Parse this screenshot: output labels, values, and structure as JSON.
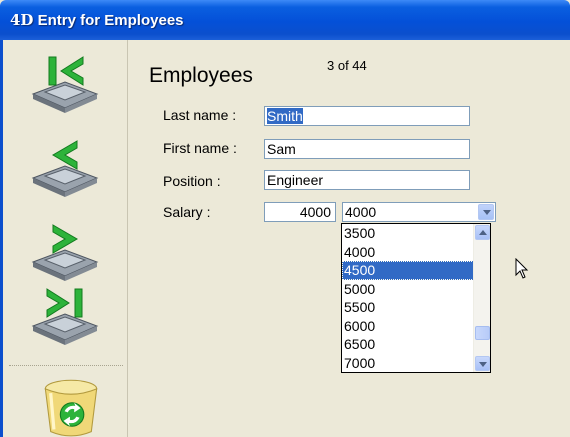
{
  "window": {
    "logo": "4D",
    "title": "Entry for Employees"
  },
  "toolbar": {
    "buttons": [
      {
        "name": "first-record",
        "icon": "first-record-icon"
      },
      {
        "name": "previous-record",
        "icon": "previous-record-icon"
      },
      {
        "name": "next-record",
        "icon": "next-record-icon"
      },
      {
        "name": "last-record",
        "icon": "last-record-icon"
      },
      {
        "name": "delete-record",
        "icon": "trash-icon"
      }
    ]
  },
  "form": {
    "title": "Employees",
    "counter": "3 of 44",
    "last_name_label": "Last name :",
    "last_name_value": "Smith",
    "first_name_label": "First name :",
    "first_name_value": "Sam",
    "position_label": "Position :",
    "position_value": "Engineer",
    "salary_label": "Salary :",
    "salary_value": "4000",
    "salary_combo_value": "4000",
    "salary_options": [
      "3500",
      "4000",
      "4500",
      "5000",
      "5500",
      "6000",
      "6500",
      "7000"
    ],
    "salary_highlighted": "4500"
  },
  "colors": {
    "titlebar": "#0450d8",
    "selection": "#316ac5",
    "arrow_green": "#2db33a"
  }
}
